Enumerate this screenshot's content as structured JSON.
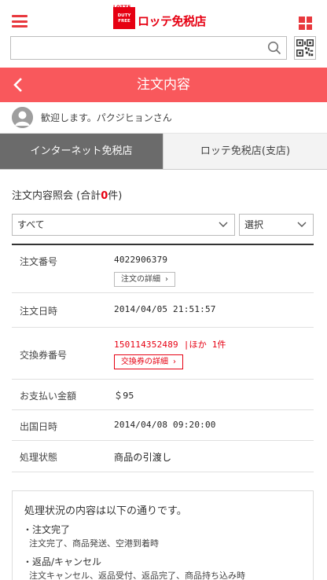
{
  "header": {
    "logo_small_top": "LOTTE",
    "logo_badge_line1": "DUTY",
    "logo_badge_line2": "FREE",
    "logo_text": "ロッテ免税店"
  },
  "search": {
    "value": "",
    "placeholder": ""
  },
  "page": {
    "title": "注文内容"
  },
  "welcome": {
    "text": "歓迎します。パクジヒョンさん"
  },
  "tabs": [
    {
      "label": "インターネット免税店",
      "active": true
    },
    {
      "label": "ロッテ免税店(支店)",
      "active": false
    }
  ],
  "query": {
    "prefix": "注文内容照会 (合計",
    "count": "0",
    "suffix": "件)"
  },
  "filters": {
    "status_selected": "すべて",
    "period_selected": "選択"
  },
  "order": {
    "number_label": "注文番号",
    "number_value": "4022906379",
    "detail_button": "注文の詳細",
    "date_label": "注文日時",
    "date_value": "2014/04/05 21:51:57",
    "voucher_label": "交換券番号",
    "voucher_value": "150114352489 |ほか 1件",
    "voucher_button": "交換券の詳細",
    "amount_label": "お支払い金額",
    "amount_value": "＄95",
    "departure_label": "出国日時",
    "departure_value": "2014/04/08 09:20:00",
    "status_label": "処理状態",
    "status_value": "商品の引渡し"
  },
  "notes": {
    "title": "処理状況の内容は以下の通りです。",
    "items": [
      {
        "label": "・注文完了",
        "desc": "注文完了、商品発送、空港到着時"
      },
      {
        "label": "・返品/キャンセル",
        "desc": "注文キャンセル、返品受付、返品完了、商品持ち込み時"
      }
    ]
  },
  "colors": {
    "brand_red": "#e60012",
    "title_bar": "#f9585c",
    "active_tab": "#6b6b6b"
  },
  "icons": [
    "hamburger-menu-icon",
    "grid-menu-icon",
    "search-icon",
    "qr-code-icon",
    "back-arrow-icon",
    "user-avatar-icon",
    "chevron-down-icon",
    "chevron-right-icon"
  ]
}
